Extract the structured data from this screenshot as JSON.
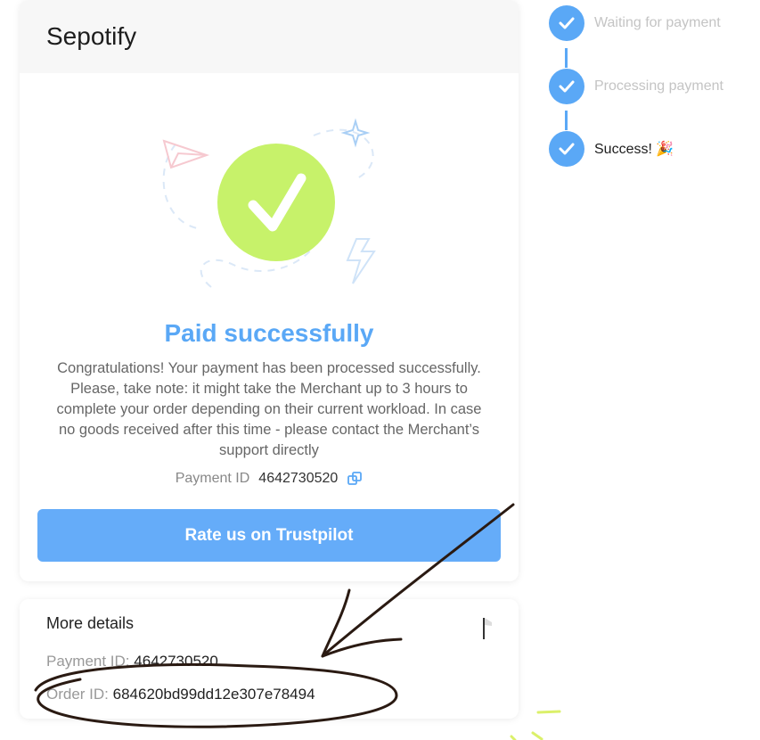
{
  "merchant": {
    "name": "Sepotify"
  },
  "status": {
    "title": "Paid successfully",
    "message": "Congratulations! Your payment has been processed successfully. Please, take note: it might take the Merchant up to 3 hours to complete your order depending on their current workload. In case no goods received after this time - please contact the Merchant’s support directly",
    "icon": "check-circle-icon",
    "color": "#5aa8f6",
    "badge_color": "#c7f26a"
  },
  "payment": {
    "id_label": "Payment ID",
    "id_value": "4642730520"
  },
  "actions": {
    "rate_label": "Rate us on Trustpilot",
    "rate_color": "#65acf9"
  },
  "details": {
    "title": "More details",
    "payment_id_label": "Payment ID:",
    "payment_id_value": "4642730520",
    "order_id_label": "Order ID:",
    "order_id_value": "684620bd99dd12e307e78494"
  },
  "steps": [
    {
      "label": "Waiting for payment",
      "state": "done"
    },
    {
      "label": "Processing payment",
      "state": "done"
    },
    {
      "label": "Success! 🎉",
      "state": "current"
    }
  ]
}
